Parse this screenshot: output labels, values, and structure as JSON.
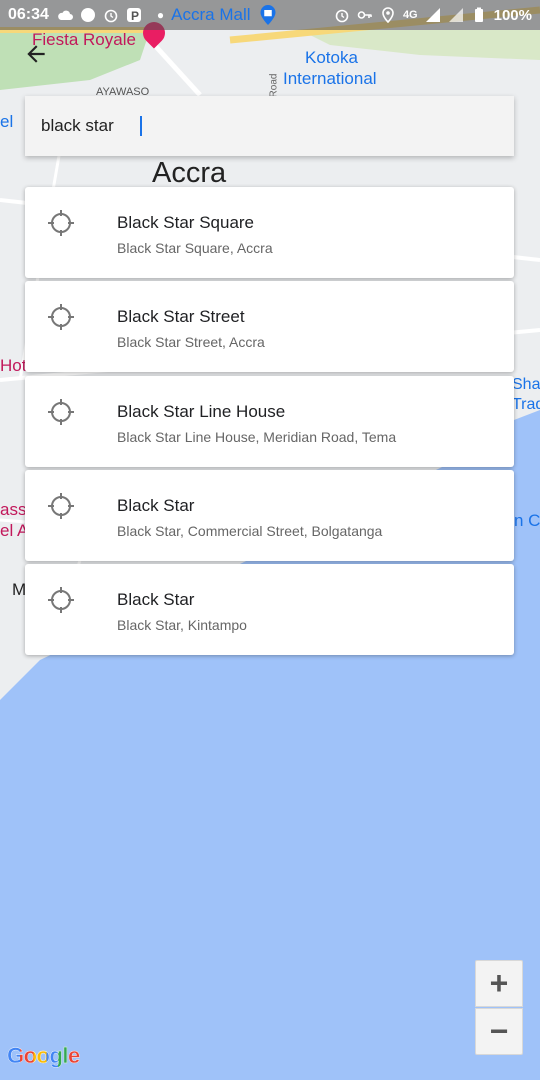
{
  "status_bar": {
    "time": "06:34",
    "notification_text": "Accra Mall",
    "network": "4G",
    "battery": "100%"
  },
  "search": {
    "value": "black star"
  },
  "map_labels": {
    "fiesta": "Fiesta Royale",
    "kotoka": "Kotoka",
    "airport": "International",
    "ayawaso": "AYAWASO",
    "accra": "Accra",
    "road": "Road",
    "hotel_left": "Hote",
    "el_left": "el",
    "el_a": "el A",
    "assa": "assa",
    "m_left": "M",
    "sha": "Shar",
    "trad": "Trad",
    "ncl": "n Cl"
  },
  "suggestions": [
    {
      "title": "Black Star Square",
      "subtitle": "Black Star Square, Accra",
      "icon": "crosshair-icon"
    },
    {
      "title": "Black Star Street",
      "subtitle": "Black Star Street, Accra",
      "icon": "crosshair-icon"
    },
    {
      "title": "Black Star Line House",
      "subtitle": "Black Star Line House, Meridian Road, Tema",
      "icon": "crosshair-icon"
    },
    {
      "title": "Black Star",
      "subtitle": "Black Star, Commercial Street, Bolgatanga",
      "icon": "crosshair-icon"
    },
    {
      "title": "Black Star",
      "subtitle": "Black Star, Kintampo",
      "icon": "crosshair-icon"
    }
  ],
  "zoom": {
    "in_label": "+",
    "out_label": "−"
  },
  "logo": {
    "text": "Google"
  },
  "colors": {
    "water": "#9fc2f9",
    "land": "#eceef0",
    "accent": "#1a73e8"
  }
}
